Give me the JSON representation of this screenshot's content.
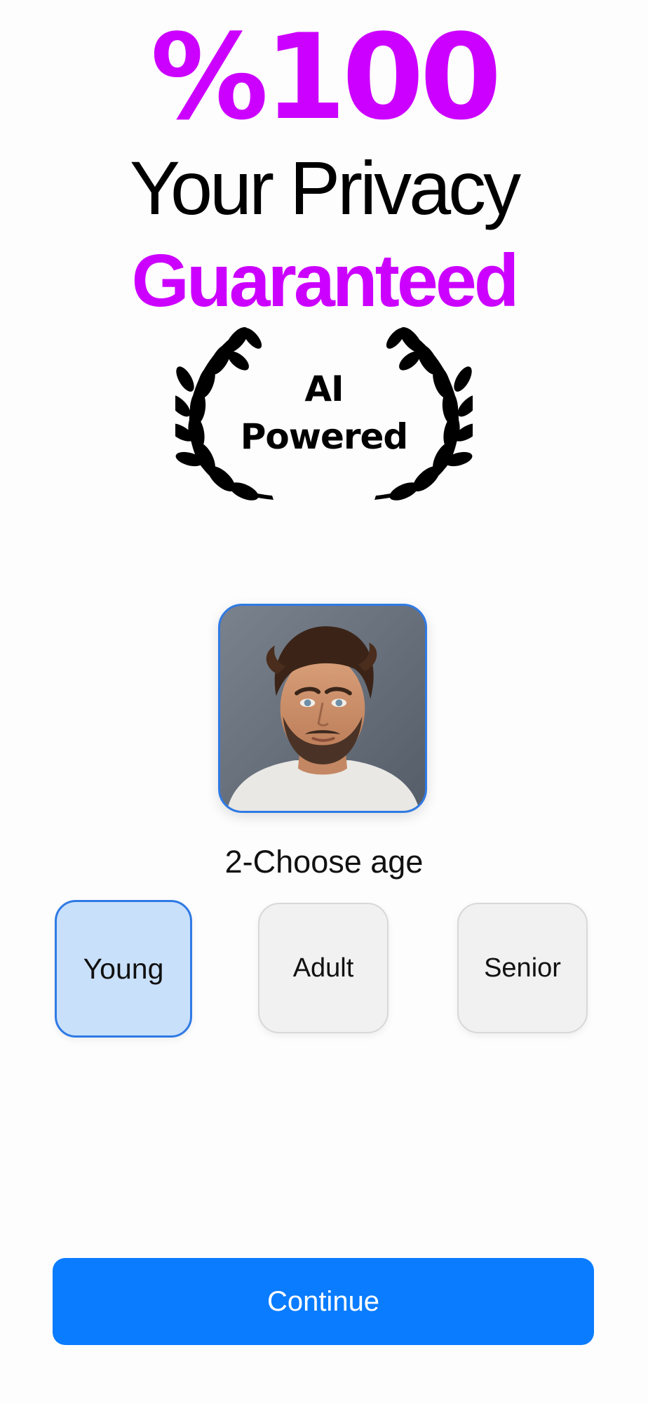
{
  "hero": {
    "percent": "%100",
    "line1": "Your Privacy",
    "line2": "Guaranteed"
  },
  "badge": {
    "line1": "AI",
    "line2": "Powered",
    "icon": "laurel-wreath-icon"
  },
  "portrait": {
    "icon": "face-portrait-image"
  },
  "age_selection": {
    "label": "2-Choose age",
    "options": [
      {
        "label": "Young",
        "selected": true
      },
      {
        "label": "Adult",
        "selected": false
      },
      {
        "label": "Senior",
        "selected": false
      }
    ]
  },
  "continue_button": {
    "label": "Continue"
  },
  "colors": {
    "accent_purple": "#cc00ff",
    "primary_blue": "#0a7cff",
    "selected_bg": "#c9e0fa",
    "selected_border": "#2f7ae5"
  }
}
